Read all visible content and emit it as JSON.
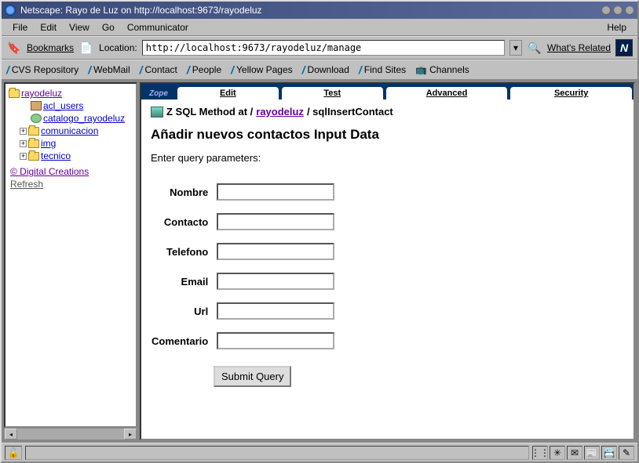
{
  "titlebar": {
    "title": "Netscape: Rayo de Luz on http://localhost:9673/rayodeluz"
  },
  "menubar": {
    "items": [
      "File",
      "Edit",
      "View",
      "Go",
      "Communicator"
    ],
    "help": "Help"
  },
  "toolbar": {
    "bookmarks": "Bookmarks",
    "location_label": "Location:",
    "location_value": "http://localhost:9673/rayodeluz/manage",
    "whats_related": "What's Related"
  },
  "personal_toolbar": {
    "items": [
      "CVS Repository",
      "WebMail",
      "Contact",
      "People",
      "Yellow Pages",
      "Download",
      "Find Sites",
      "Channels"
    ]
  },
  "sidebar": {
    "root": "rayodeluz",
    "children": [
      {
        "label": "acl_users",
        "icon": "users"
      },
      {
        "label": "catalogo_rayodeluz",
        "icon": "catalog"
      },
      {
        "label": "comunicacion",
        "icon": "folder",
        "expandable": true
      },
      {
        "label": "img",
        "icon": "folder",
        "expandable": true
      },
      {
        "label": "tecnico",
        "icon": "folder",
        "expandable": true
      }
    ],
    "digital_creations": "© Digital Creations",
    "refresh": "Refresh"
  },
  "main": {
    "logo": "Zope",
    "tabs": [
      "Edit",
      "Test",
      "Advanced",
      "Security"
    ],
    "breadcrumb_prefix": "Z SQL Method at /",
    "breadcrumb_link": "rayodeluz",
    "breadcrumb_suffix": " / sqlInsertContact",
    "heading": "Añadir nuevos contactos Input Data",
    "prompt": "Enter query parameters:",
    "fields": [
      {
        "label": "Nombre"
      },
      {
        "label": "Contacto"
      },
      {
        "label": "Telefono"
      },
      {
        "label": "Email"
      },
      {
        "label": "Url"
      },
      {
        "label": "Comentario"
      }
    ],
    "submit": "Submit Query"
  }
}
